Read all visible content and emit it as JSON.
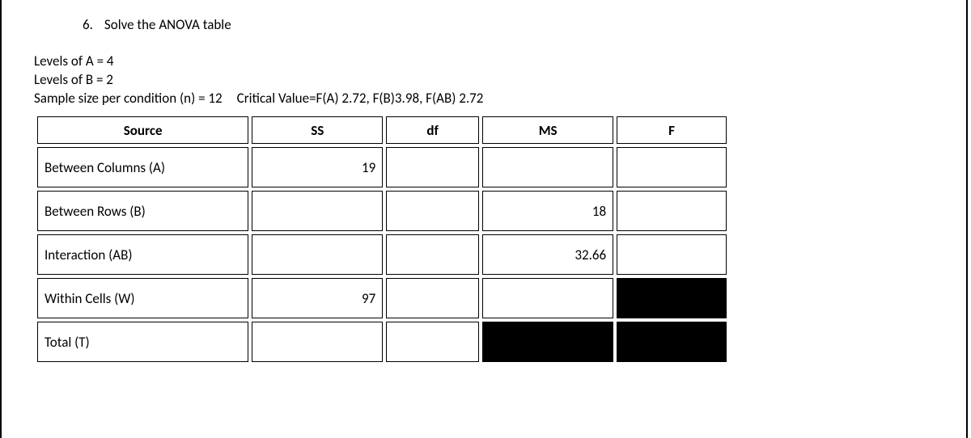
{
  "question": {
    "number": "6.",
    "text": "Solve the ANOVA table"
  },
  "given": {
    "levels_a": "Levels of A  = 4",
    "levels_b": "Levels of B  = 2",
    "sample_size": "Sample size per condition (n) = 12",
    "critical": "Critical Value=F(A) 2.72, F(B)3.98, F(AB) 2.72"
  },
  "headers": {
    "source": "Source",
    "ss": "SS",
    "df": "df",
    "ms": "MS",
    "f": "F"
  },
  "rows": {
    "a": {
      "label": "Between Columns (A)",
      "ss": "19",
      "df": "",
      "ms": "",
      "f": ""
    },
    "b": {
      "label": "Between Rows (B)",
      "ss": "",
      "df": "",
      "ms": "18",
      "f": ""
    },
    "ab": {
      "label": "Interaction (AB)",
      "ss": "",
      "df": "",
      "ms": "32.66",
      "f": ""
    },
    "w": {
      "label": "Within Cells (W)",
      "ss": "97",
      "df": "",
      "ms": ""
    },
    "t": {
      "label": "Total (T)",
      "ss": "",
      "df": ""
    }
  },
  "chart_data": {
    "type": "table",
    "title": "ANOVA table",
    "columns": [
      "Source",
      "SS",
      "df",
      "MS",
      "F"
    ],
    "rows": [
      {
        "Source": "Between Columns (A)",
        "SS": 19,
        "df": null,
        "MS": null,
        "F": null
      },
      {
        "Source": "Between Rows (B)",
        "SS": null,
        "df": null,
        "MS": 18,
        "F": null
      },
      {
        "Source": "Interaction (AB)",
        "SS": null,
        "df": null,
        "MS": 32.66,
        "F": null
      },
      {
        "Source": "Within Cells (W)",
        "SS": 97,
        "df": null,
        "MS": null,
        "F": "blacked-out"
      },
      {
        "Source": "Total (T)",
        "SS": null,
        "df": null,
        "MS": "blacked-out",
        "F": "blacked-out"
      }
    ],
    "parameters": {
      "levels_A": 4,
      "levels_B": 2,
      "n_per_condition": 12,
      "critical_values": {
        "F(A)": 2.72,
        "F(B)": 3.98,
        "F(AB)": 2.72
      }
    }
  }
}
